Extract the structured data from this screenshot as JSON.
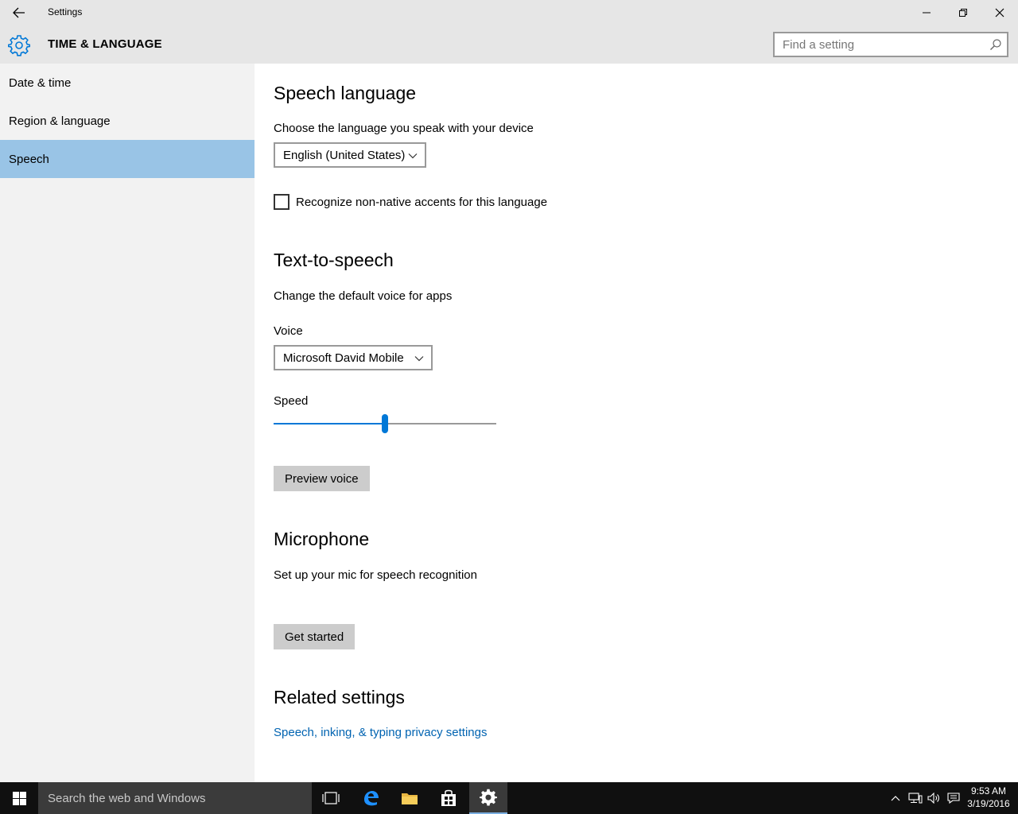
{
  "window": {
    "title": "Settings"
  },
  "header": {
    "title": "TIME & LANGUAGE",
    "search_placeholder": "Find a setting"
  },
  "sidebar": {
    "items": [
      {
        "label": "Date & time",
        "active": false
      },
      {
        "label": "Region & language",
        "active": false
      },
      {
        "label": "Speech",
        "active": true
      }
    ]
  },
  "speech_language": {
    "heading": "Speech language",
    "description": "Choose the language you speak with your device",
    "language_value": "English (United States)",
    "accents_label": "Recognize non-native accents for this language",
    "accents_checked": false
  },
  "tts": {
    "heading": "Text-to-speech",
    "description": "Change the default voice for apps",
    "voice_label": "Voice",
    "voice_value": "Microsoft David Mobile",
    "speed_label": "Speed",
    "speed_fraction": 0.5,
    "preview_button": "Preview voice"
  },
  "microphone": {
    "heading": "Microphone",
    "description": "Set up your mic for speech recognition",
    "button": "Get started"
  },
  "related": {
    "heading": "Related settings",
    "link": "Speech, inking, & typing privacy settings"
  },
  "taskbar": {
    "search_placeholder": "Search the web and Windows",
    "time": "9:53 AM",
    "date": "3/19/2016"
  },
  "colors": {
    "accent": "#0078d7",
    "selected_nav": "#99c4e6",
    "link": "#0063b1"
  }
}
